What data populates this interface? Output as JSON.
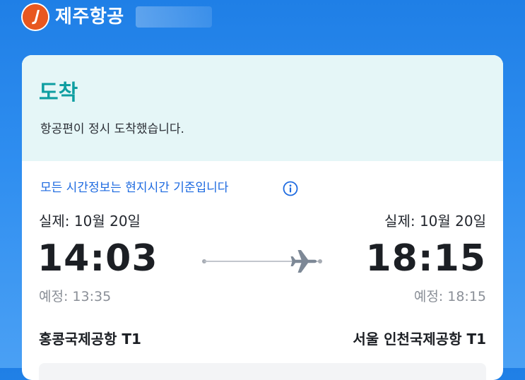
{
  "header": {
    "brand": "제주항공",
    "logo_icon": "jeju-air-logo-icon",
    "brand_color": "#e8571f"
  },
  "status": {
    "title": "도착",
    "message": "항공편이 정시 도착했습니다.",
    "title_color": "#0e9ea1",
    "background": "#e5f6f7"
  },
  "notice": {
    "text": "모든 시간정보는 현지시간 기준입니다",
    "icon": "info-icon",
    "color": "#1d6ae0"
  },
  "departure": {
    "actual_label": "실제: 10월 20일",
    "time": "14:03",
    "scheduled": "예정: 13:35",
    "airport": "홍콩국제공항 T1"
  },
  "arrival": {
    "actual_label": "실제: 10월 20일",
    "time": "18:15",
    "scheduled": "예정: 18:15",
    "airport": "서울 인천국제공항 T1"
  },
  "route": {
    "icon": "airplane-icon"
  }
}
